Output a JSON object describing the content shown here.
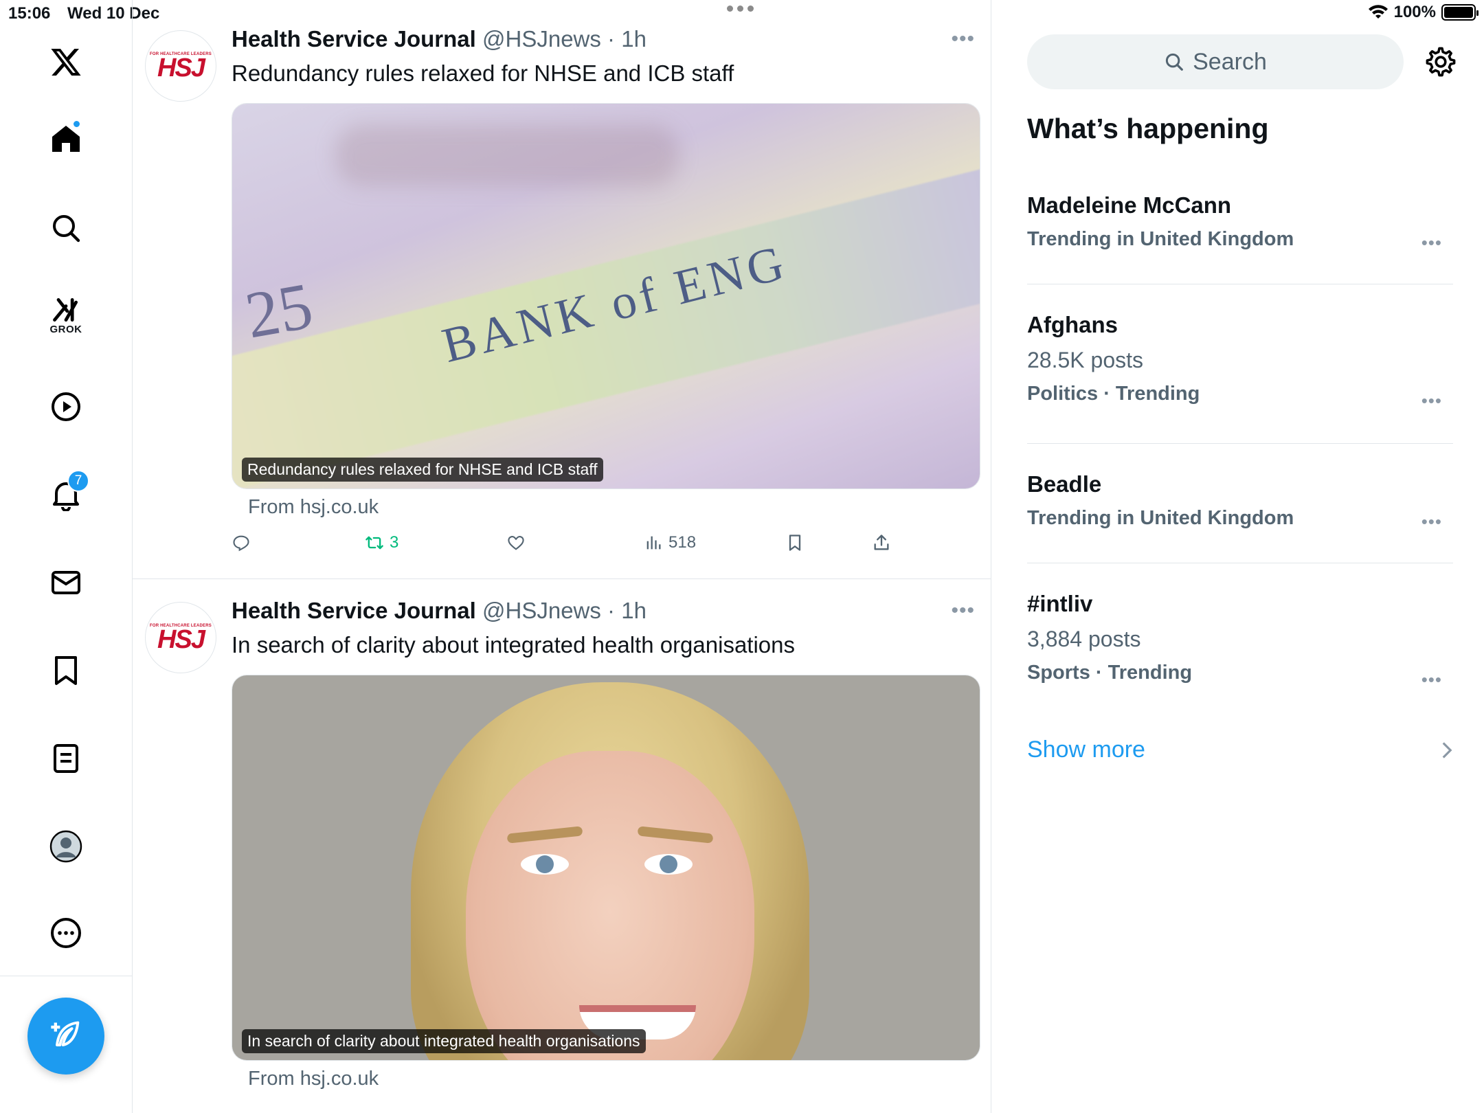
{
  "status_bar": {
    "time": "15:06",
    "date": "Wed 10 Dec",
    "battery": "100%"
  },
  "nav": {
    "items": [
      {
        "name": "X logo",
        "icon": "x-logo-icon"
      },
      {
        "name": "Home",
        "icon": "home-icon"
      },
      {
        "name": "Explore",
        "icon": "search-icon"
      },
      {
        "name": "Grok",
        "icon": "grok-icon",
        "label": "GROK"
      },
      {
        "name": "Video",
        "icon": "play-icon"
      },
      {
        "name": "Notifications",
        "icon": "bell-icon",
        "badge": "7"
      },
      {
        "name": "Messages",
        "icon": "mail-icon"
      },
      {
        "name": "Bookmarks",
        "icon": "bookmark-icon"
      },
      {
        "name": "Lists",
        "icon": "list-icon"
      },
      {
        "name": "Profile",
        "icon": "profile-icon"
      },
      {
        "name": "More",
        "icon": "more-icon"
      }
    ],
    "compose_icon": "compose-icon"
  },
  "tweets": [
    {
      "author": "Health Service Journal",
      "handle": "@HSJnews",
      "sep": " · ",
      "time": "1h",
      "avatar_text": "HSJ",
      "avatar_tagline": "FOR HEALTHCARE LEADERS",
      "text": "Redundancy rules relaxed for NHSE and ICB staff",
      "card_caption": "Redundancy rules relaxed for NHSE and ICB staff",
      "card_source": "From hsj.co.uk",
      "card_image_text": "BANK of ENG",
      "card_image_num": "25",
      "retweets": "3",
      "views": "518"
    },
    {
      "author": "Health Service Journal",
      "handle": "@HSJnews",
      "sep": " · ",
      "time": "1h",
      "avatar_text": "HSJ",
      "avatar_tagline": "FOR HEALTHCARE LEADERS",
      "text": "In search of clarity about integrated health organisations",
      "card_caption": "In search of clarity about integrated health organisations",
      "card_source": "From hsj.co.uk"
    }
  ],
  "sidebar": {
    "search_placeholder": "Search",
    "title": "What’s happening",
    "trends": [
      {
        "name": "Madeleine McCann",
        "posts": "",
        "meta": "Trending in United Kingdom"
      },
      {
        "name": "Afghans",
        "posts": "28.5K posts",
        "meta": "Politics · Trending"
      },
      {
        "name": "Beadle",
        "posts": "",
        "meta": "Trending in United Kingdom"
      },
      {
        "name": "#intliv",
        "posts": "3,884 posts",
        "meta": "Sports · Trending"
      }
    ],
    "show_more": "Show more"
  },
  "colors": {
    "accent": "#1d9bf0",
    "retweet": "#00ba7c",
    "secondary_text": "#536471",
    "hsj_red": "#c8102e"
  }
}
